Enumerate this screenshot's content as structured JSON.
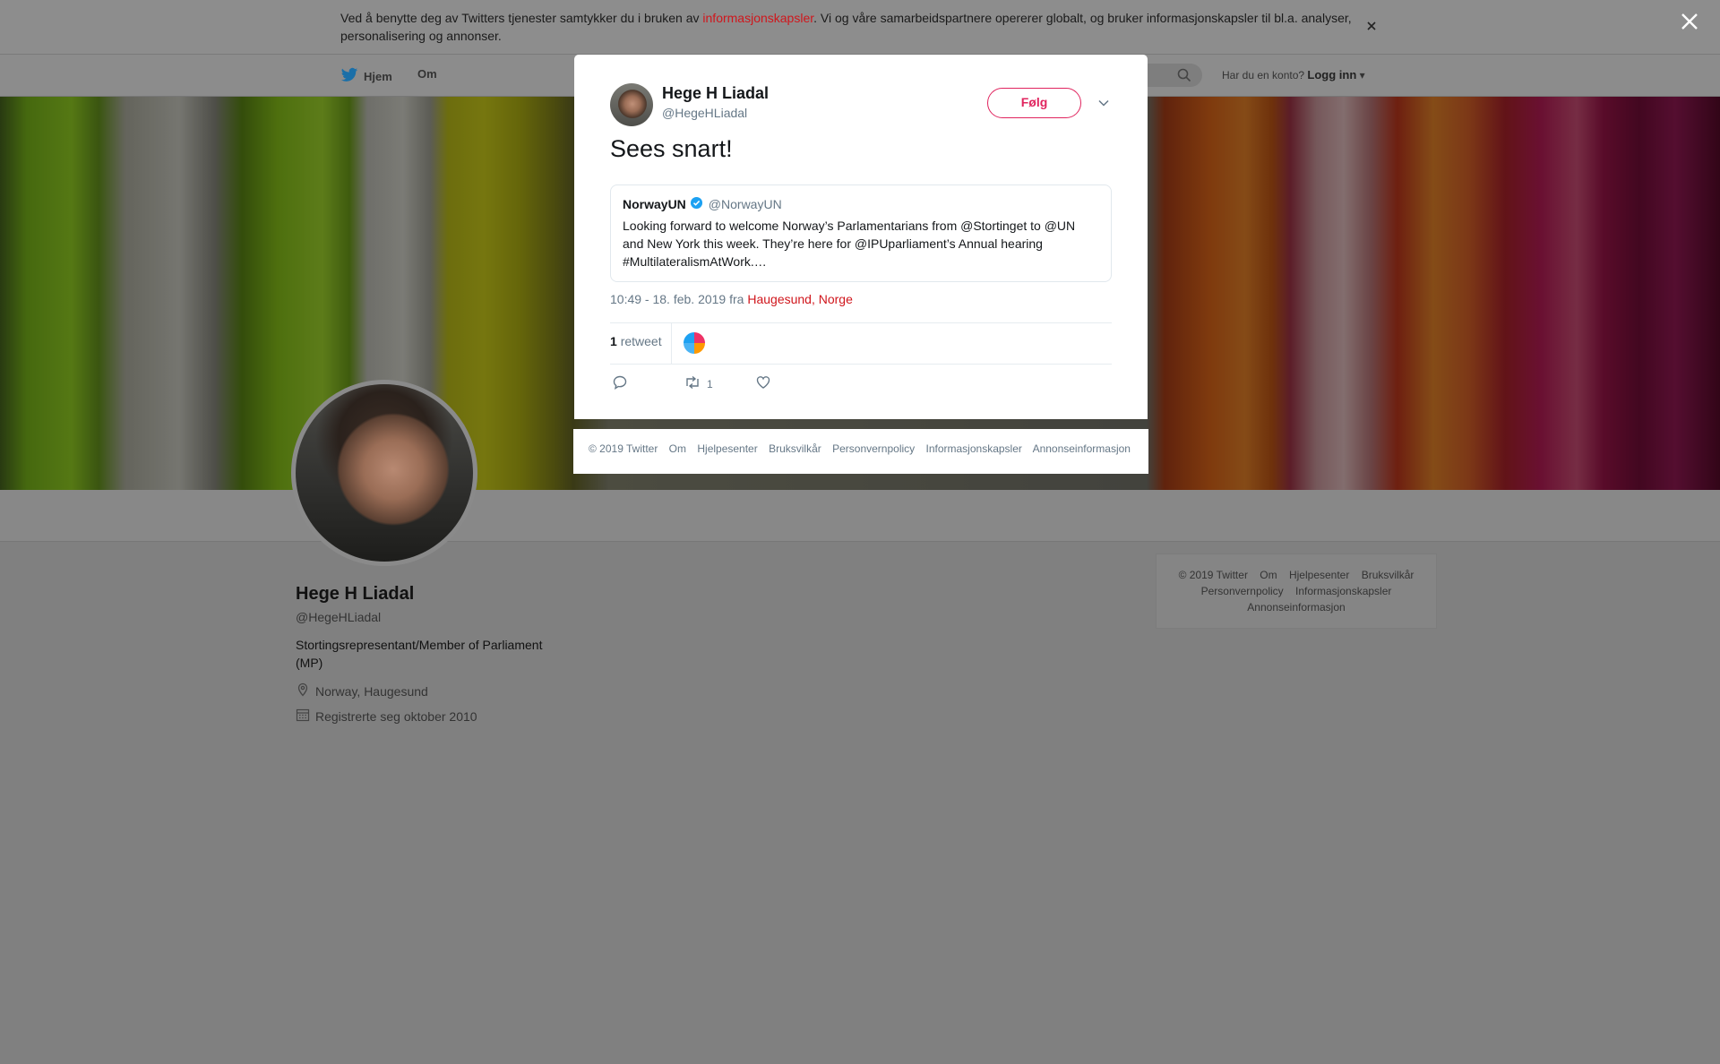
{
  "cookie": {
    "text_before": "Ved å benytte deg av Twitters tjenester samtykker du i bruken av ",
    "link": "informasjonskapsler",
    "text_after": ". Vi og våre samarbeidspartnere opererer globalt, og bruker informasjonskapsler til bl.a. analyser, personalisering og annonser.",
    "close_icon": "close-icon"
  },
  "nav": {
    "home": "Hjem",
    "about": "Om",
    "login_prompt": "Har du en konto?",
    "login": "Logg inn"
  },
  "profile": {
    "name": "Hege H Liadal",
    "handle": "@HegeHLiadal",
    "bio": "Stortingsrepresentant/Member of Parliament (MP)",
    "location": "Norway, Haugesund",
    "joined": "Registrerte seg oktober 2010"
  },
  "side_footer": {
    "items": [
      "© 2019 Twitter",
      "Om",
      "Hjelpesenter",
      "Bruksvilkår",
      "Personvernpolicy",
      "Informasjonskapsler",
      "Annonseinformasjon"
    ]
  },
  "tweet": {
    "author_name": "Hege H Liadal",
    "author_handle": "@HegeHLiadal",
    "follow": "Følg",
    "text": "Sees snart!",
    "quote": {
      "name": "NorwayUN",
      "handle": "@NorwayUN",
      "text": "Looking forward to welcome Norway’s Parlamentarians from @Stortinget to @UN and New York this week. They’re here for @IPUparliament’s Annual hearing #MultilateralismAtWork.…"
    },
    "time": "10:49 - 18. feb. 2019 fra ",
    "place": "Haugesund, Norge",
    "retweet_count": "1",
    "retweet_label": "retweet",
    "retweet_action_count": "1"
  },
  "modal_footer": {
    "items": [
      "© 2019 Twitter",
      "Om",
      "Hjelpesenter",
      "Bruksvilkår",
      "Personvernpolicy",
      "Informasjonskapsler",
      "Annonseinformasjon"
    ]
  },
  "colors": {
    "accent": "#e0245e",
    "link_red": "#d0161c",
    "twitter_blue": "#1da1f2"
  }
}
